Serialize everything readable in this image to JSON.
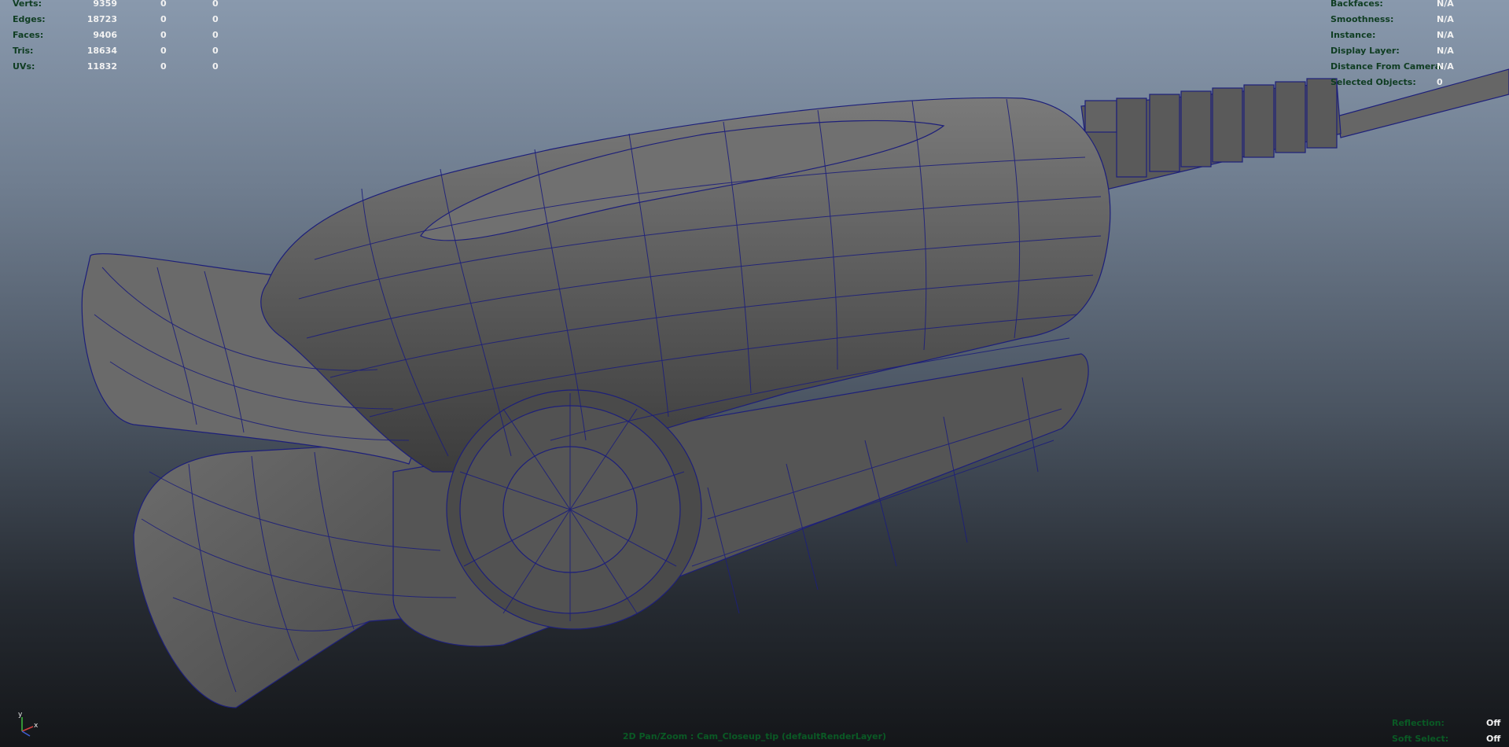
{
  "stats": {
    "rows": [
      {
        "label": "Verts:",
        "value": "9359",
        "sel": "0",
        "uvsel": "0"
      },
      {
        "label": "Edges:",
        "value": "18723",
        "sel": "0",
        "uvsel": "0"
      },
      {
        "label": "Faces:",
        "value": "9406",
        "sel": "0",
        "uvsel": "0"
      },
      {
        "label": "Tris:",
        "value": "18634",
        "sel": "0",
        "uvsel": "0"
      },
      {
        "label": "UVs:",
        "value": "11832",
        "sel": "0",
        "uvsel": "0"
      }
    ]
  },
  "object_info": {
    "rows": [
      {
        "label": "Backfaces:",
        "value": "N/A"
      },
      {
        "label": "Smoothness:",
        "value": "N/A"
      },
      {
        "label": "Instance:",
        "value": "N/A"
      },
      {
        "label": "Display Layer:",
        "value": "N/A"
      },
      {
        "label": "Distance From Camera:",
        "value": "N/A"
      },
      {
        "label": "Selected Objects:",
        "value": "0"
      }
    ]
  },
  "viewport_flags": {
    "rows": [
      {
        "label": "Reflection:",
        "value": "Off"
      },
      {
        "label": "Soft Select:",
        "value": "Off"
      }
    ]
  },
  "camera_label": "2D Pan/Zoom : Cam_Closeup_tip (defaultRenderLayer)",
  "axis": {
    "y": "y",
    "x": "x"
  },
  "colors": {
    "wireframe": "#1d1f7a",
    "mesh_fill": "#5c5c5c",
    "hud_label": "#0f3d22",
    "hud_value": "#f2f2f2"
  }
}
